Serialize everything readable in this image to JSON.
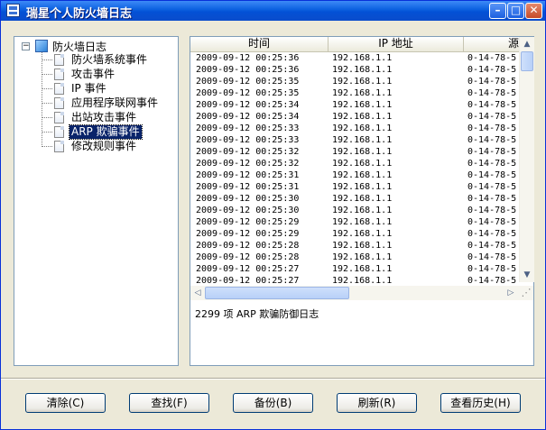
{
  "window": {
    "title": "瑞星个人防火墙日志",
    "minimize": "–",
    "maximize": "□",
    "close": "✕"
  },
  "tree": {
    "root_label": "防火墙日志",
    "expander": "−",
    "items": [
      {
        "label": "防火墙系统事件"
      },
      {
        "label": "攻击事件"
      },
      {
        "label": "IP 事件"
      },
      {
        "label": "应用程序联网事件"
      },
      {
        "label": "出站攻击事件"
      },
      {
        "label": "ARP 欺骗事件",
        "selected": true
      },
      {
        "label": "修改规则事件"
      }
    ]
  },
  "list": {
    "columns": [
      "时间",
      "IP 地址",
      "源"
    ],
    "rows": [
      [
        "2009-09-12 00:25:36",
        "192.168.1.1",
        "0-14-78-5"
      ],
      [
        "2009-09-12 00:25:36",
        "192.168.1.1",
        "0-14-78-5"
      ],
      [
        "2009-09-12 00:25:35",
        "192.168.1.1",
        "0-14-78-5"
      ],
      [
        "2009-09-12 00:25:35",
        "192.168.1.1",
        "0-14-78-5"
      ],
      [
        "2009-09-12 00:25:34",
        "192.168.1.1",
        "0-14-78-5"
      ],
      [
        "2009-09-12 00:25:34",
        "192.168.1.1",
        "0-14-78-5"
      ],
      [
        "2009-09-12 00:25:33",
        "192.168.1.1",
        "0-14-78-5"
      ],
      [
        "2009-09-12 00:25:33",
        "192.168.1.1",
        "0-14-78-5"
      ],
      [
        "2009-09-12 00:25:32",
        "192.168.1.1",
        "0-14-78-5"
      ],
      [
        "2009-09-12 00:25:32",
        "192.168.1.1",
        "0-14-78-5"
      ],
      [
        "2009-09-12 00:25:31",
        "192.168.1.1",
        "0-14-78-5"
      ],
      [
        "2009-09-12 00:25:31",
        "192.168.1.1",
        "0-14-78-5"
      ],
      [
        "2009-09-12 00:25:30",
        "192.168.1.1",
        "0-14-78-5"
      ],
      [
        "2009-09-12 00:25:30",
        "192.168.1.1",
        "0-14-78-5"
      ],
      [
        "2009-09-12 00:25:29",
        "192.168.1.1",
        "0-14-78-5"
      ],
      [
        "2009-09-12 00:25:29",
        "192.168.1.1",
        "0-14-78-5"
      ],
      [
        "2009-09-12 00:25:28",
        "192.168.1.1",
        "0-14-78-5"
      ],
      [
        "2009-09-12 00:25:28",
        "192.168.1.1",
        "0-14-78-5"
      ],
      [
        "2009-09-12 00:25:27",
        "192.168.1.1",
        "0-14-78-5"
      ],
      [
        "2009-09-12 00:25:27",
        "192.168.1.1",
        "0-14-78-5"
      ]
    ],
    "status_text": "2299 项 ARP 欺骗防御日志",
    "scroll_up": "▲",
    "scroll_down": "▼",
    "scroll_left": "◁",
    "scroll_right": "▷",
    "resize_grip": "⋰"
  },
  "buttons": {
    "clear": "清除(C)",
    "find": "查找(F)",
    "backup": "备份(B)",
    "refresh": "刷新(R)",
    "history": "查看历史(H)"
  }
}
